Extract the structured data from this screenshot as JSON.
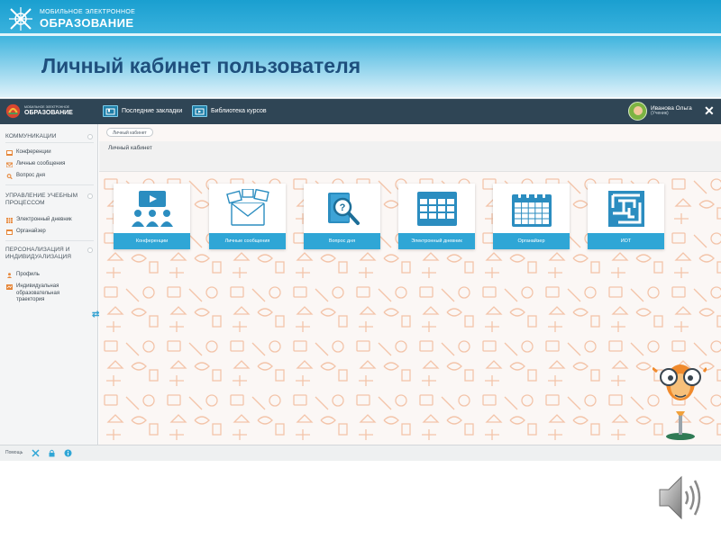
{
  "slide": {
    "logo_small": "МОБИЛЬНОЕ ЭЛЕКТРОННОЕ",
    "logo_big": "ОБРАЗОВАНИЕ",
    "title": "Личный кабинет пользователя"
  },
  "topbar": {
    "logo_small": "МОБИЛЬНОЕ ЭЛЕКТРОННОЕ",
    "logo_big": "ОБРАЗОВАНИЕ",
    "bookmarks_label": "Последние закладки",
    "library_label": "Библиотека курсов",
    "user_name": "Иванова Ольга",
    "user_role": "(Ученик)",
    "close_glyph": "✕"
  },
  "sidebar": {
    "sections": [
      {
        "title": "КОММУНИКАЦИИ",
        "items": [
          {
            "label": "Конференции",
            "icon": "conference-icon"
          },
          {
            "label": "Личные сообщения",
            "icon": "messages-icon"
          },
          {
            "label": "Вопрос дня",
            "icon": "search-icon"
          }
        ]
      },
      {
        "title": "УПРАВЛЕНИЕ УЧЕБНЫМ ПРОЦЕССОМ",
        "items": [
          {
            "label": "Электронный дневник",
            "icon": "diary-icon"
          },
          {
            "label": "Органайзер",
            "icon": "organizer-icon"
          }
        ]
      },
      {
        "title": "ПЕРСОНАЛИЗАЦИЯ И ИНДИВИДУАЛИЗАЦИЯ",
        "items": [
          {
            "label": "Профиль",
            "icon": "profile-icon"
          },
          {
            "label": "Индивидуальная образовательная траектория",
            "icon": "trajectory-icon"
          }
        ]
      }
    ],
    "toggle_glyph": "⇄"
  },
  "main": {
    "breadcrumb": "Личный кабинет",
    "title": "Личный кабинет",
    "tiles": [
      {
        "label": "Конференции",
        "icon": "conference-icon"
      },
      {
        "label": "Личные сообщения",
        "icon": "messages-icon"
      },
      {
        "label": "Вопрос дня",
        "icon": "question-book-icon"
      },
      {
        "label": "Электронный дневник",
        "icon": "diary-grid-icon"
      },
      {
        "label": "Органайзер",
        "icon": "calendar-icon"
      },
      {
        "label": "ИОТ",
        "icon": "maze-icon"
      }
    ]
  },
  "statusbar": {
    "help_label": "Помощь"
  },
  "colors": {
    "header_blue": "#1a9fd0",
    "title_navy": "#1e4f7d",
    "topbar": "#2f4555",
    "accent_blue": "#2fa6d6",
    "sidebar_orange": "#e6873a",
    "pattern_peach": "#f3c4a9"
  }
}
